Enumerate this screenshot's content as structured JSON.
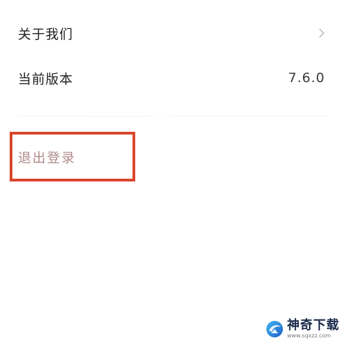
{
  "settings": {
    "about": {
      "label": "关于我们",
      "icon": "chevron-right-icon"
    },
    "version": {
      "label": "当前版本",
      "value": "7.6.0"
    },
    "logout": {
      "label": "退出登录"
    }
  },
  "watermark": {
    "name": "神奇下载",
    "url": "www.sqxzz.com",
    "icon": "watermark-logo-icon"
  },
  "colors": {
    "highlight": "#d9462b",
    "logout_text": "#b08a8a"
  }
}
